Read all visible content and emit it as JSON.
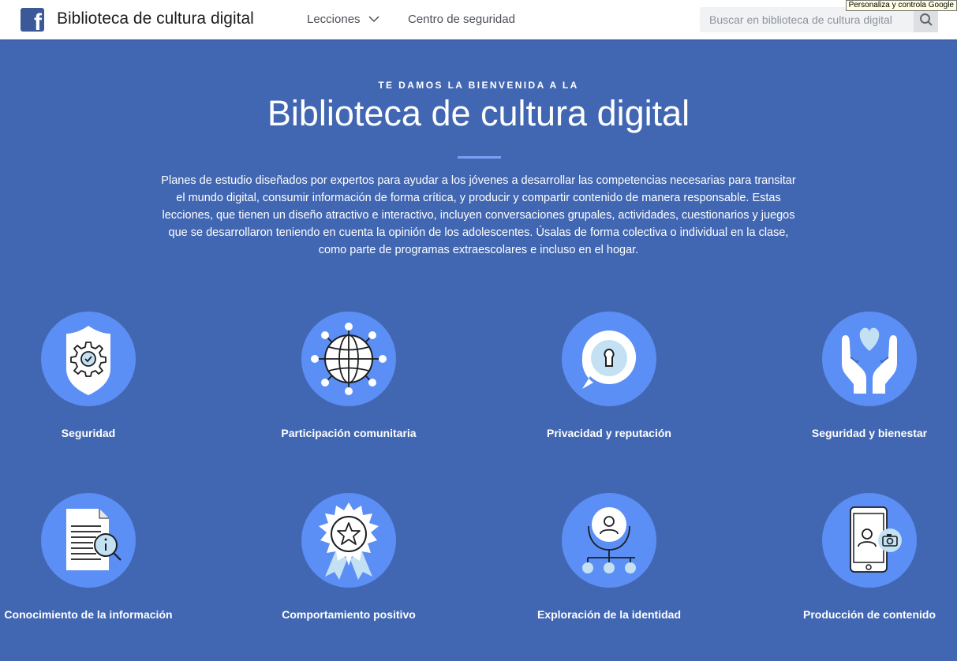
{
  "header": {
    "title": "Biblioteca de cultura digital",
    "nav": [
      {
        "label": "Lecciones"
      },
      {
        "label": "Centro de seguridad"
      }
    ],
    "search_placeholder": "Buscar en biblioteca de cultura digital"
  },
  "tooltip": "Personaliza y controla Google",
  "hero": {
    "kicker": "TE DAMOS LA BIENVENIDA A LA",
    "title": "Biblioteca de cultura digital",
    "description": "Planes de estudio diseñados por expertos para ayudar a los jóvenes a desarrollar las competencias necesarias para transitar el mundo digital, consumir información de forma crítica, y producir y compartir contenido de manera responsable. Estas lecciones, que tienen un diseño atractivo e interactivo, incluyen conversaciones grupales, actividades, cuestionarios y juegos que se desarrollaron teniendo en cuenta la opinión de los adolescentes. Úsalas de forma colectiva o individual en la clase, como parte de programas extraescolares e incluso en el hogar."
  },
  "topics": [
    {
      "label": "Seguridad",
      "icon": "shield-gear-icon"
    },
    {
      "label": "Participación comunitaria",
      "icon": "globe-network-icon"
    },
    {
      "label": "Privacidad y reputación",
      "icon": "keyhole-bubble-icon"
    },
    {
      "label": "Seguridad y bienestar",
      "icon": "hands-heart-icon"
    },
    {
      "label": "Conocimiento de la información",
      "icon": "document-magnifier-icon"
    },
    {
      "label": "Comportamiento positivo",
      "icon": "star-badge-icon"
    },
    {
      "label": "Exploración de la identidad",
      "icon": "person-tree-icon"
    },
    {
      "label": "Producción de contenido",
      "icon": "phone-camera-icon"
    }
  ],
  "colors": {
    "background": "#4267b2",
    "circle": "#5b8ff5",
    "light_accent": "#c4e1f3",
    "brand": "#3b5998"
  }
}
